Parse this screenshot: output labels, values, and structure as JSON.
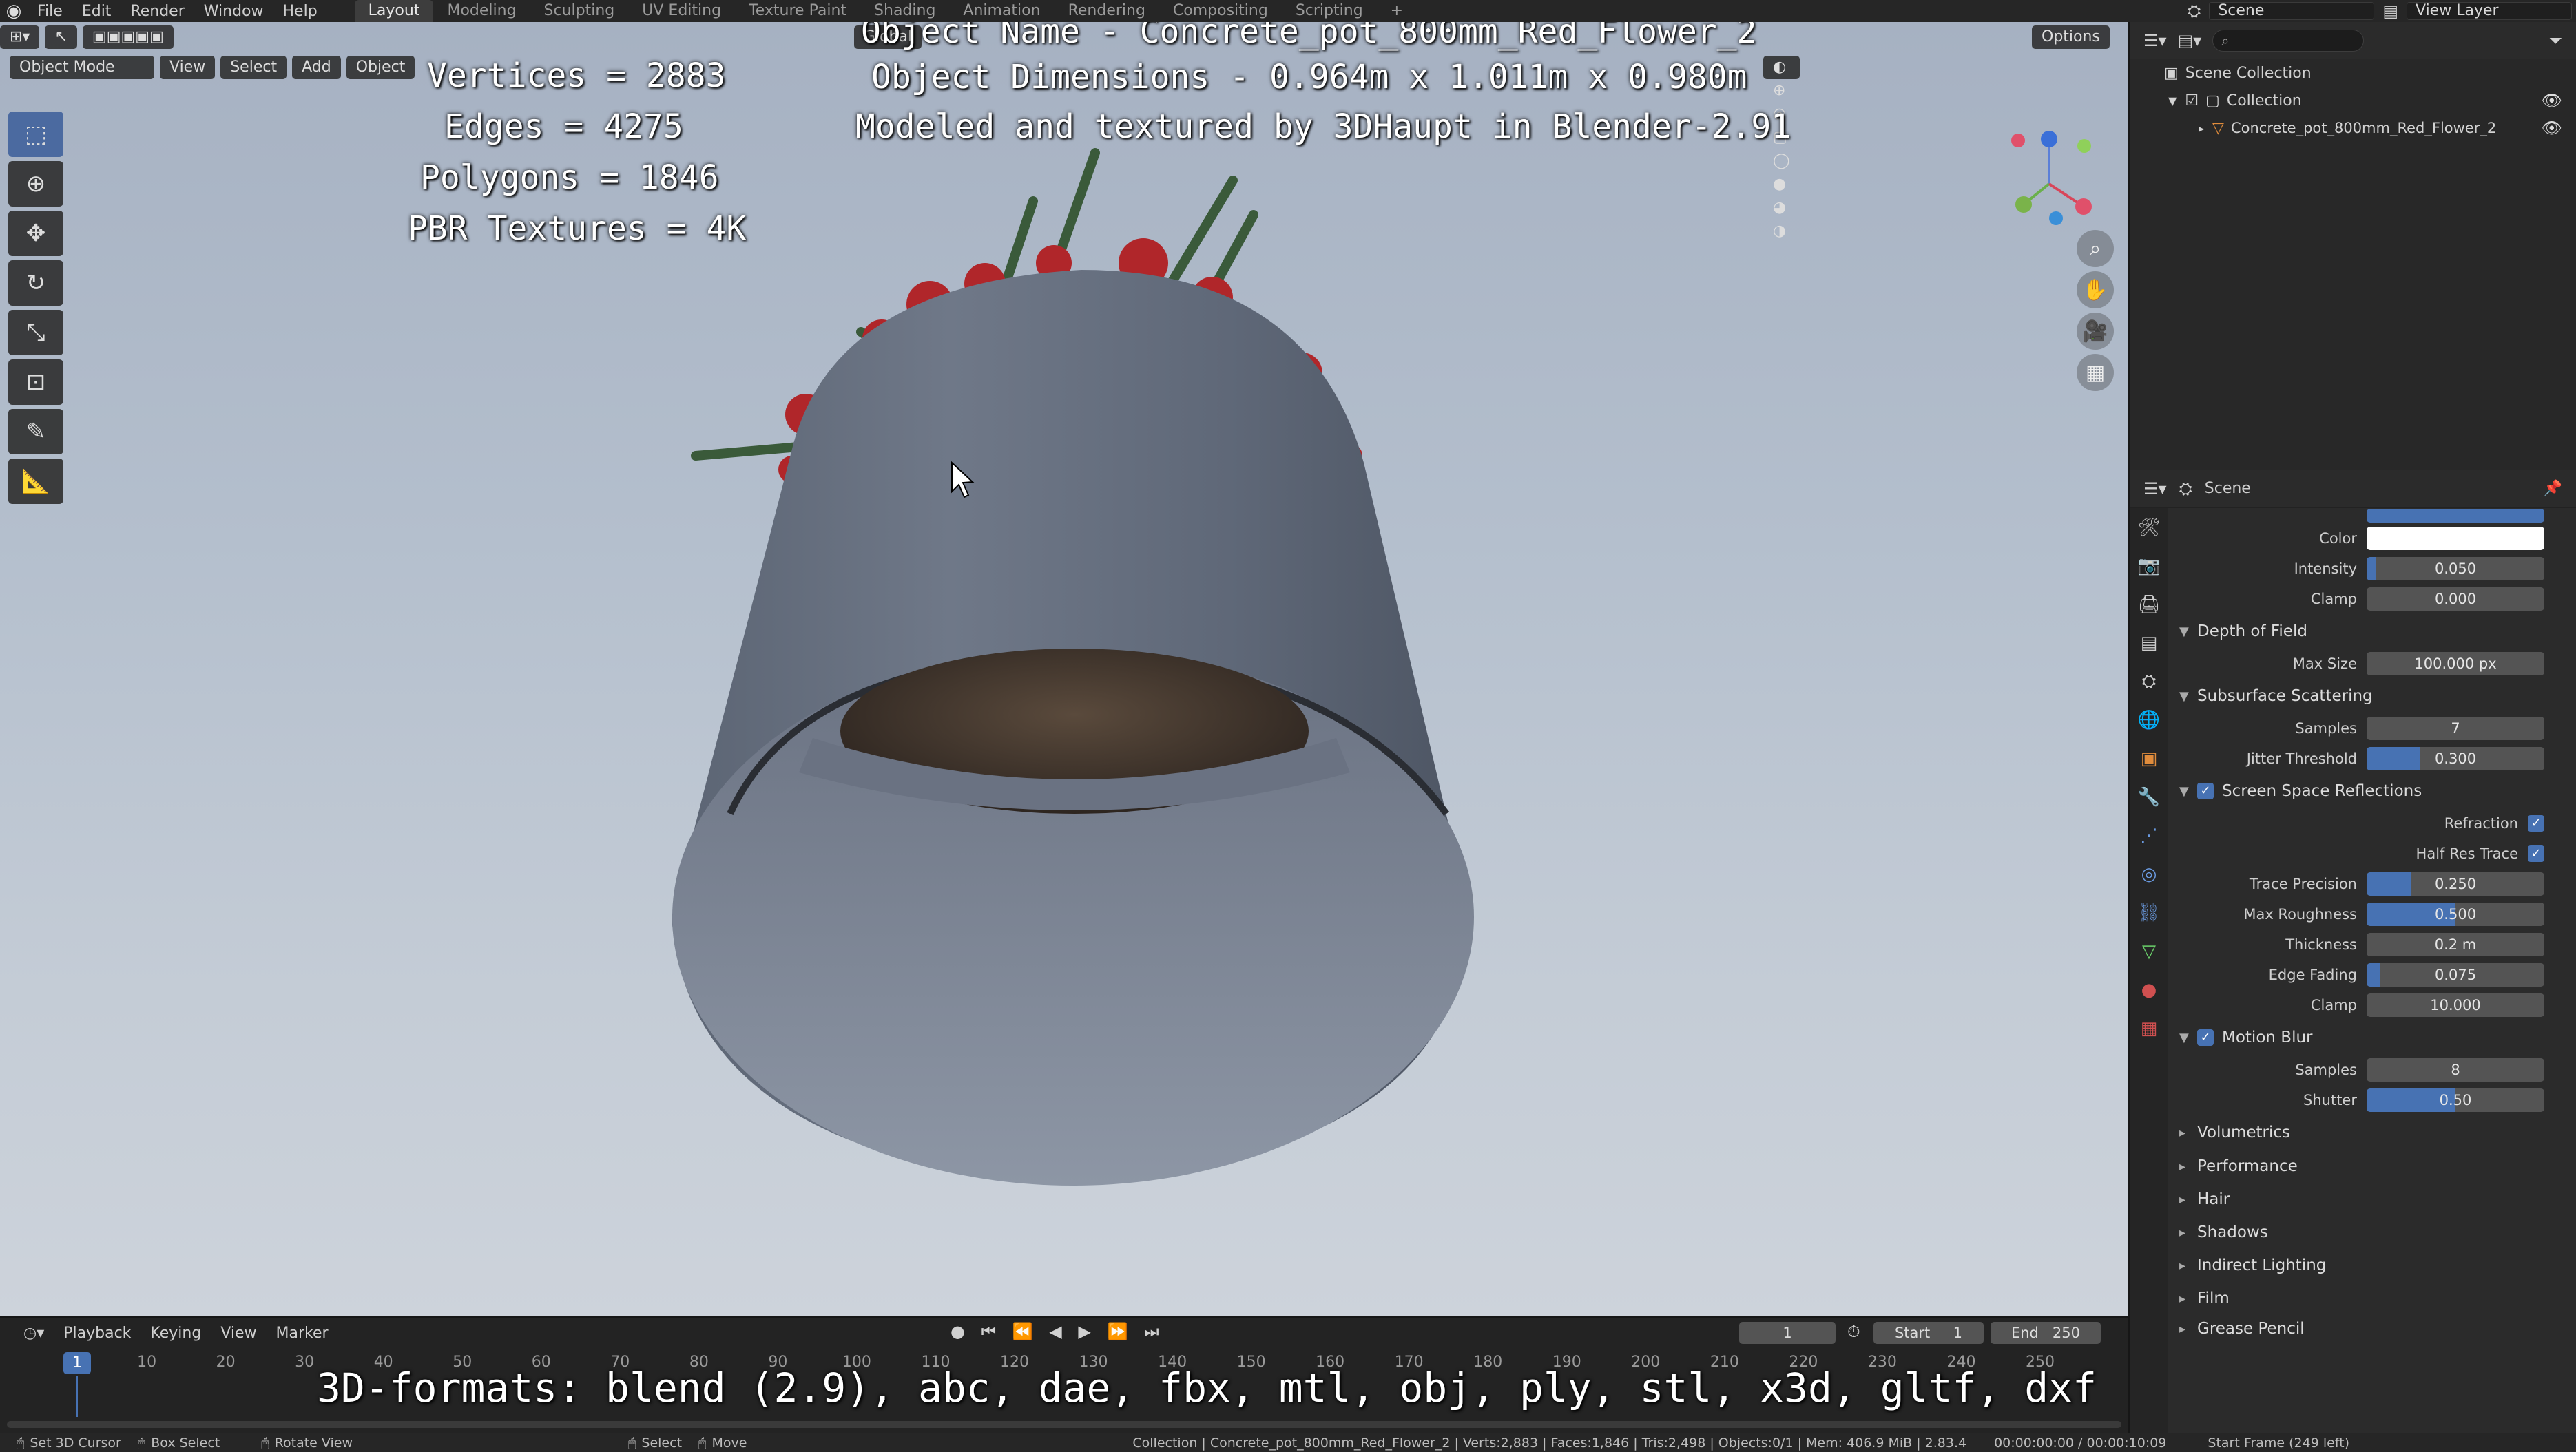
{
  "menu": {
    "items": [
      "File",
      "Edit",
      "Render",
      "Window",
      "Help"
    ],
    "workspaces": [
      "Layout",
      "Modeling",
      "Sculpting",
      "UV Editing",
      "Texture Paint",
      "Shading",
      "Animation",
      "Rendering",
      "Compositing",
      "Scripting"
    ],
    "active_workspace": "Layout",
    "scene": "Scene",
    "view_layer": "View Layer"
  },
  "viewport": {
    "mode": "Object Mode",
    "menus": [
      "View",
      "Select",
      "Add",
      "Object"
    ],
    "transform_orientation": "Global",
    "options_label": "Options",
    "overlay_stats": {
      "vertices": "Vertices = 2883",
      "edges": "Edges = 4275",
      "polygons": "Polygons = 1846",
      "textures": "PBR Textures = 4K"
    },
    "overlay_info": {
      "name": "Object Name - Concrete_pot_800mm_Red_Flower_2",
      "dimensions": "Object Dimensions -  0.964m x 1.011m x 0.980m",
      "credit": "Modeled and textured by 3DHaupt in Blender-2.91"
    },
    "formats": "3D-formats: blend (2.9), abc, dae, fbx, mtl, obj, ply, stl, x3d, gltf, dxf"
  },
  "outliner": {
    "scene_collection": "Scene Collection",
    "collection": "Collection",
    "object": "Concrete_pot_800mm_Red_Flower_2"
  },
  "properties": {
    "context": "Scene",
    "ao": {
      "color_label": "Color",
      "color": "#ffffff",
      "intensity_label": "Intensity",
      "intensity": "0.050",
      "intensity_fill": 0.05,
      "clamp_label": "Clamp",
      "clamp": "0.000"
    },
    "dof": {
      "title": "Depth of Field",
      "max_size_label": "Max Size",
      "max_size": "100.000 px"
    },
    "sss": {
      "title": "Subsurface Scattering",
      "samples_label": "Samples",
      "samples": "7",
      "jitter_label": "Jitter Threshold",
      "jitter": "0.300",
      "jitter_fill": 0.3
    },
    "ssr": {
      "title": "Screen Space Reflections",
      "enabled": true,
      "refraction_label": "Refraction",
      "half_res_label": "Half Res Trace",
      "trace_precision_label": "Trace Precision",
      "trace_precision": "0.250",
      "trace_precision_fill": 0.25,
      "max_roughness_label": "Max Roughness",
      "max_roughness": "0.500",
      "max_roughness_fill": 0.5,
      "thickness_label": "Thickness",
      "thickness": "0.2 m",
      "edge_fading_label": "Edge Fading",
      "edge_fading": "0.075",
      "edge_fading_fill": 0.075,
      "clamp_label": "Clamp",
      "clamp": "10.000"
    },
    "motion_blur": {
      "title": "Motion Blur",
      "enabled": true,
      "samples_label": "Samples",
      "samples": "8",
      "shutter_label": "Shutter",
      "shutter": "0.50",
      "shutter_fill": 0.5
    },
    "collapsed": [
      "Volumetrics",
      "Performance",
      "Hair",
      "Shadows",
      "Indirect Lighting",
      "Film",
      "Grease Pencil"
    ]
  },
  "timeline": {
    "menus": [
      "Playback",
      "Keying",
      "View",
      "Marker"
    ],
    "current_frame": "1",
    "start_label": "Start",
    "start": "1",
    "end_label": "End",
    "end": "250",
    "ticks": [
      "10",
      "20",
      "30",
      "40",
      "50",
      "60",
      "70",
      "80",
      "90",
      "100",
      "110",
      "120",
      "130",
      "140",
      "150",
      "160",
      "170",
      "180",
      "190",
      "200",
      "210",
      "220",
      "230",
      "240",
      "250"
    ],
    "playhead": "1"
  },
  "statusbar": {
    "left": [
      "Set 3D Cursor",
      "Box Select",
      "Rotate View",
      "Select",
      "Move"
    ],
    "info": "Collection | Concrete_pot_800mm_Red_Flower_2 | Verts:2,883 | Faces:1,846 | Tris:2,498 | Objects:0/1 | Mem: 406.9 MiB | 2.83.4",
    "time": "00:00:00:00 / 00:00:10:09",
    "frame": "Start Frame (249 left)"
  }
}
